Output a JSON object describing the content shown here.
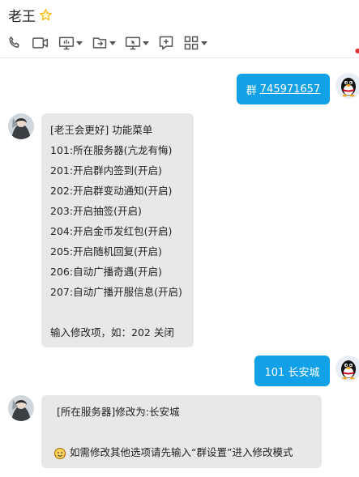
{
  "window": {
    "title": "老王"
  },
  "toolbar": {
    "items": [
      {
        "icon": "phone-icon"
      },
      {
        "icon": "video-icon"
      },
      {
        "icon": "screen-share-icon"
      },
      {
        "icon": "file-transfer-icon"
      },
      {
        "icon": "remote-desktop-icon"
      },
      {
        "icon": "add-chat-icon"
      },
      {
        "icon": "apps-grid-icon"
      }
    ]
  },
  "messages": [
    {
      "from": "me",
      "prefix": "群",
      "link": "745971657"
    },
    {
      "from": "other",
      "lines": [
        "[老王会更好] 功能菜单",
        "101:所在服务器(亢龙有悔)",
        "201:开启群内签到(开启)",
        "202:开启群变动通知(开启)",
        "203:开启抽签(开启)",
        "204:开启金币发红包(开启)",
        "205:开启随机回复(开启)",
        "206:自动广播奇遇(开启)",
        "207:自动广播开服信息(开启)",
        "",
        "输入修改项，如：202 关闭"
      ]
    },
    {
      "from": "me",
      "text": "101 长安城"
    },
    {
      "from": "other",
      "lines": [
        "[所在服务器]修改为:长安城",
        "",
        "如需修改其他选项请先输入“群设置”进入修改模式"
      ]
    }
  ],
  "colors": {
    "bubble_out": "#12a0e6",
    "bubble_in": "#e8e8e8",
    "star": "#f5b800"
  }
}
